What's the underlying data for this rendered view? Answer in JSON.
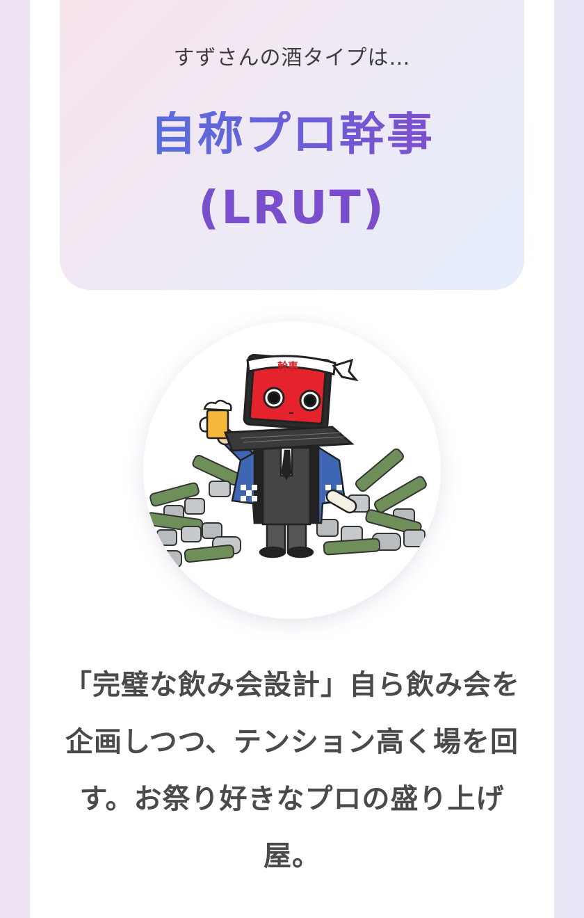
{
  "result": {
    "subtitle": "すずさんの酒タイプは…",
    "type_name": "自称プロ幹事",
    "type_code": "(LRUT)"
  },
  "illustration": {
    "headband_text": "幹事",
    "icon": "laptop-head-party-organizer-illustration"
  },
  "description": "「完璧な飲み会設計」自ら飲み会を企画しつつ、テンション高く場を回す。お祭り好きなプロの盛り上げ屋。"
}
